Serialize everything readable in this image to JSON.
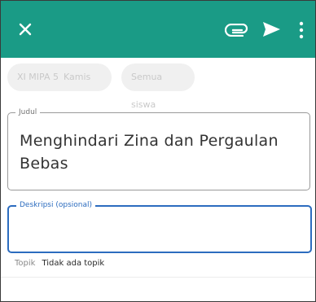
{
  "colors": {
    "appbar": "#1a9b86",
    "icon": "#ffffff",
    "focus": "#2c6cbf"
  },
  "toolbar": {
    "close_icon": "close-icon",
    "attach_icon": "attachment-icon",
    "send_icon": "send-icon",
    "more_icon": "more-vert-icon"
  },
  "chips": {
    "class_name": "XI MIPA 5",
    "day": "Kamis",
    "students": "Semua siswa"
  },
  "title_field": {
    "label": "Judul",
    "value": "Menghindari Zina dan Pergaulan Bebas"
  },
  "description_field": {
    "label": "Deskripsi (opsional)",
    "value": ""
  },
  "topic": {
    "label": "Topik",
    "value": "Tidak ada topik"
  }
}
